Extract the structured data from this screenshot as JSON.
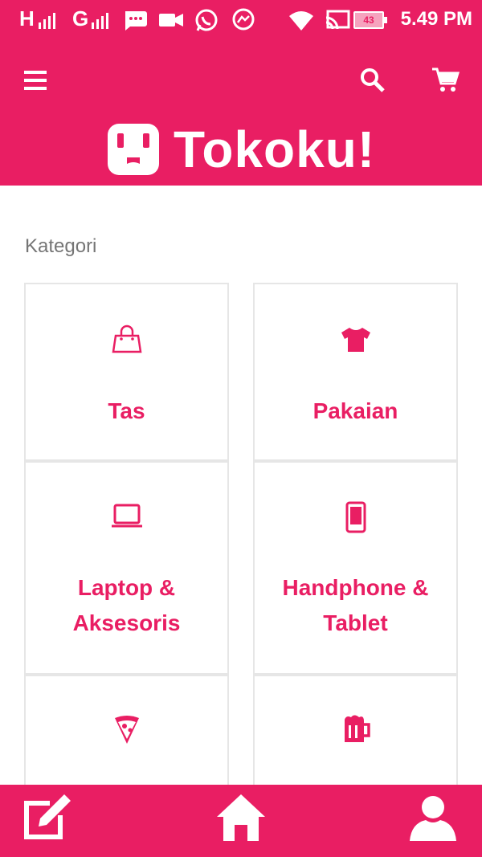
{
  "status_bar": {
    "signal_1": "H",
    "signal_2": "G",
    "battery": "43",
    "time": "5.49 PM",
    "icons": [
      "chat-icon",
      "video-icon",
      "whatsapp-icon",
      "messenger-icon",
      "wifi-icon",
      "cast-icon",
      "battery-icon"
    ]
  },
  "app_bar": {
    "menu_icon": "hamburger-icon",
    "search_icon": "search-icon",
    "cart_icon": "cart-icon",
    "brand_name": "Tokoku!",
    "accent_color": "#e91e63"
  },
  "content": {
    "section_title": "Kategori",
    "categories": [
      {
        "label": "Tas",
        "icon": "bag-icon"
      },
      {
        "label": "Pakaian",
        "icon": "shirt-icon"
      },
      {
        "label_line1": "Laptop &",
        "label_line2": "Aksesoris",
        "icon": "laptop-icon"
      },
      {
        "label_line1": "Handphone &",
        "label_line2": "Tablet",
        "icon": "phone-icon"
      },
      {
        "icon": "pizza-icon"
      },
      {
        "icon": "beer-mug-icon"
      }
    ]
  },
  "bottom_nav": {
    "items": [
      {
        "icon": "edit-icon"
      },
      {
        "icon": "home-icon"
      },
      {
        "icon": "profile-icon"
      }
    ]
  }
}
